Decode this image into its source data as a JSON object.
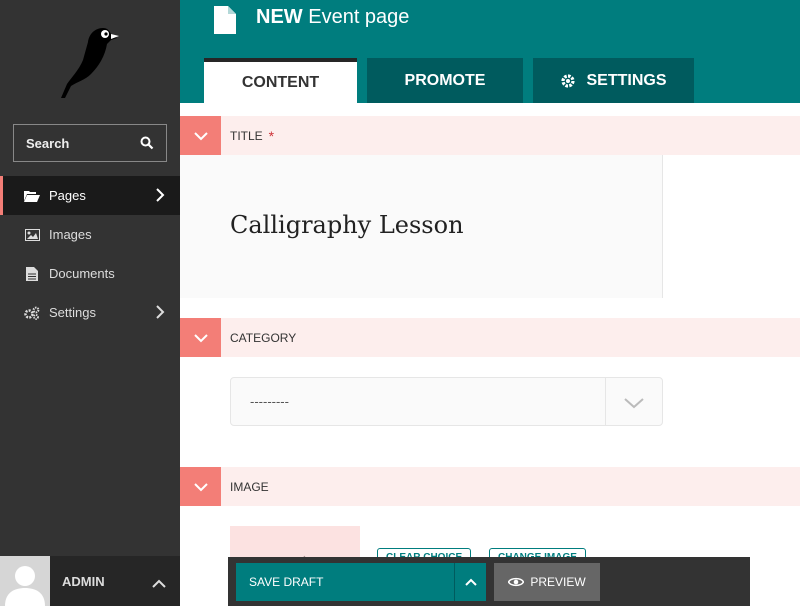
{
  "sidebar": {
    "search_label": "Search",
    "items": [
      {
        "label": "Pages",
        "icon": "folder-open-icon"
      },
      {
        "label": "Images",
        "icon": "image-icon"
      },
      {
        "label": "Documents",
        "icon": "document-icon"
      },
      {
        "label": "Settings",
        "icon": "cogs-icon"
      }
    ],
    "account_name": "ADMIN"
  },
  "header": {
    "title_strong": "NEW",
    "title_rest": "Event page",
    "tabs": [
      {
        "label": "CONTENT"
      },
      {
        "label": "PROMOTE"
      },
      {
        "label": "SETTINGS"
      }
    ]
  },
  "fields": {
    "title": {
      "label": "TITLE",
      "required_mark": "*",
      "value": "Calligraphy Lesson"
    },
    "category": {
      "label": "CATEGORY",
      "value": "---------"
    },
    "image": {
      "label": "IMAGE",
      "clear_choice": "CLEAR CHOICE",
      "change_image": "CHANGE IMAGE"
    }
  },
  "footer": {
    "save_draft": "SAVE DRAFT",
    "preview": "PREVIEW"
  },
  "colors": {
    "brand_teal": "#007d7e",
    "dark_teal": "#005b5e",
    "accent_salmon": "#f37e77",
    "section_bg": "#fdeeed",
    "sidebar_bg": "#333333"
  }
}
